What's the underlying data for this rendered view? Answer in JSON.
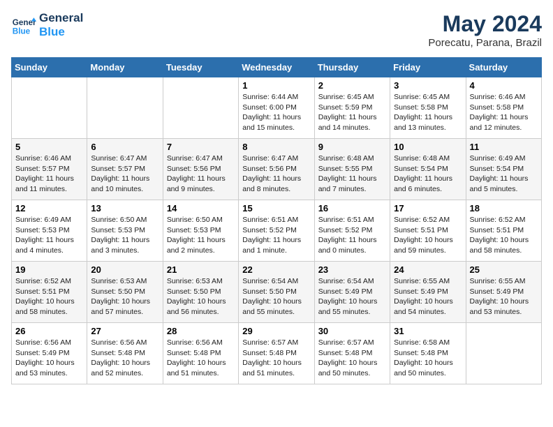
{
  "header": {
    "logo_line1": "General",
    "logo_line2": "Blue",
    "month_year": "May 2024",
    "location": "Porecatu, Parana, Brazil"
  },
  "days_of_week": [
    "Sunday",
    "Monday",
    "Tuesday",
    "Wednesday",
    "Thursday",
    "Friday",
    "Saturday"
  ],
  "weeks": [
    [
      {
        "day": "",
        "info": ""
      },
      {
        "day": "",
        "info": ""
      },
      {
        "day": "",
        "info": ""
      },
      {
        "day": "1",
        "info": "Sunrise: 6:44 AM\nSunset: 6:00 PM\nDaylight: 11 hours\nand 15 minutes."
      },
      {
        "day": "2",
        "info": "Sunrise: 6:45 AM\nSunset: 5:59 PM\nDaylight: 11 hours\nand 14 minutes."
      },
      {
        "day": "3",
        "info": "Sunrise: 6:45 AM\nSunset: 5:58 PM\nDaylight: 11 hours\nand 13 minutes."
      },
      {
        "day": "4",
        "info": "Sunrise: 6:46 AM\nSunset: 5:58 PM\nDaylight: 11 hours\nand 12 minutes."
      }
    ],
    [
      {
        "day": "5",
        "info": "Sunrise: 6:46 AM\nSunset: 5:57 PM\nDaylight: 11 hours\nand 11 minutes."
      },
      {
        "day": "6",
        "info": "Sunrise: 6:47 AM\nSunset: 5:57 PM\nDaylight: 11 hours\nand 10 minutes."
      },
      {
        "day": "7",
        "info": "Sunrise: 6:47 AM\nSunset: 5:56 PM\nDaylight: 11 hours\nand 9 minutes."
      },
      {
        "day": "8",
        "info": "Sunrise: 6:47 AM\nSunset: 5:56 PM\nDaylight: 11 hours\nand 8 minutes."
      },
      {
        "day": "9",
        "info": "Sunrise: 6:48 AM\nSunset: 5:55 PM\nDaylight: 11 hours\nand 7 minutes."
      },
      {
        "day": "10",
        "info": "Sunrise: 6:48 AM\nSunset: 5:54 PM\nDaylight: 11 hours\nand 6 minutes."
      },
      {
        "day": "11",
        "info": "Sunrise: 6:49 AM\nSunset: 5:54 PM\nDaylight: 11 hours\nand 5 minutes."
      }
    ],
    [
      {
        "day": "12",
        "info": "Sunrise: 6:49 AM\nSunset: 5:53 PM\nDaylight: 11 hours\nand 4 minutes."
      },
      {
        "day": "13",
        "info": "Sunrise: 6:50 AM\nSunset: 5:53 PM\nDaylight: 11 hours\nand 3 minutes."
      },
      {
        "day": "14",
        "info": "Sunrise: 6:50 AM\nSunset: 5:53 PM\nDaylight: 11 hours\nand 2 minutes."
      },
      {
        "day": "15",
        "info": "Sunrise: 6:51 AM\nSunset: 5:52 PM\nDaylight: 11 hours\nand 1 minute."
      },
      {
        "day": "16",
        "info": "Sunrise: 6:51 AM\nSunset: 5:52 PM\nDaylight: 11 hours\nand 0 minutes."
      },
      {
        "day": "17",
        "info": "Sunrise: 6:52 AM\nSunset: 5:51 PM\nDaylight: 10 hours\nand 59 minutes."
      },
      {
        "day": "18",
        "info": "Sunrise: 6:52 AM\nSunset: 5:51 PM\nDaylight: 10 hours\nand 58 minutes."
      }
    ],
    [
      {
        "day": "19",
        "info": "Sunrise: 6:52 AM\nSunset: 5:51 PM\nDaylight: 10 hours\nand 58 minutes."
      },
      {
        "day": "20",
        "info": "Sunrise: 6:53 AM\nSunset: 5:50 PM\nDaylight: 10 hours\nand 57 minutes."
      },
      {
        "day": "21",
        "info": "Sunrise: 6:53 AM\nSunset: 5:50 PM\nDaylight: 10 hours\nand 56 minutes."
      },
      {
        "day": "22",
        "info": "Sunrise: 6:54 AM\nSunset: 5:50 PM\nDaylight: 10 hours\nand 55 minutes."
      },
      {
        "day": "23",
        "info": "Sunrise: 6:54 AM\nSunset: 5:49 PM\nDaylight: 10 hours\nand 55 minutes."
      },
      {
        "day": "24",
        "info": "Sunrise: 6:55 AM\nSunset: 5:49 PM\nDaylight: 10 hours\nand 54 minutes."
      },
      {
        "day": "25",
        "info": "Sunrise: 6:55 AM\nSunset: 5:49 PM\nDaylight: 10 hours\nand 53 minutes."
      }
    ],
    [
      {
        "day": "26",
        "info": "Sunrise: 6:56 AM\nSunset: 5:49 PM\nDaylight: 10 hours\nand 53 minutes."
      },
      {
        "day": "27",
        "info": "Sunrise: 6:56 AM\nSunset: 5:48 PM\nDaylight: 10 hours\nand 52 minutes."
      },
      {
        "day": "28",
        "info": "Sunrise: 6:56 AM\nSunset: 5:48 PM\nDaylight: 10 hours\nand 51 minutes."
      },
      {
        "day": "29",
        "info": "Sunrise: 6:57 AM\nSunset: 5:48 PM\nDaylight: 10 hours\nand 51 minutes."
      },
      {
        "day": "30",
        "info": "Sunrise: 6:57 AM\nSunset: 5:48 PM\nDaylight: 10 hours\nand 50 minutes."
      },
      {
        "day": "31",
        "info": "Sunrise: 6:58 AM\nSunset: 5:48 PM\nDaylight: 10 hours\nand 50 minutes."
      },
      {
        "day": "",
        "info": ""
      }
    ]
  ]
}
